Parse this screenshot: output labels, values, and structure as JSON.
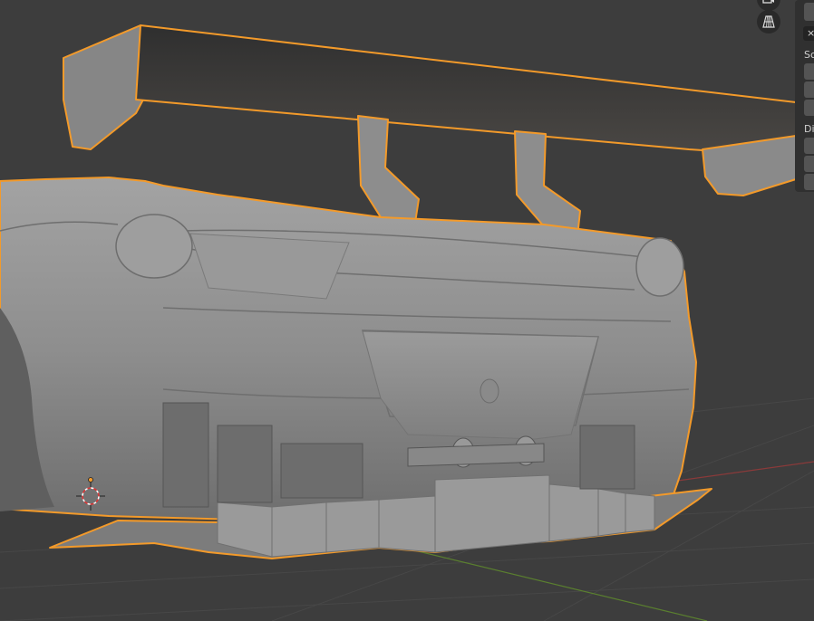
{
  "viewport": {
    "background": "#3d3d3d",
    "grid_color": "#474747",
    "axis_x_color": "#8a3a3a",
    "axis_y_color": "#5a7f2f",
    "selection_outline": "#f39a2a",
    "model_fill": "#8a8a8a"
  },
  "gizmo_buttons": [
    {
      "name": "camera-view-icon"
    },
    {
      "name": "perspective-grid-icon"
    }
  ],
  "npanel": {
    "close_label": "×",
    "section_scale_label": "Sc",
    "section_dimensions_label": "Di"
  },
  "scene": {
    "objects": [
      {
        "name": "rear-wing",
        "selected": true
      },
      {
        "name": "car-body",
        "selected": true
      },
      {
        "name": "rear-diffuser",
        "selected": true
      }
    ],
    "cursor_icon": "3d-cursor-icon",
    "origin_icon": "object-origin-icon"
  }
}
